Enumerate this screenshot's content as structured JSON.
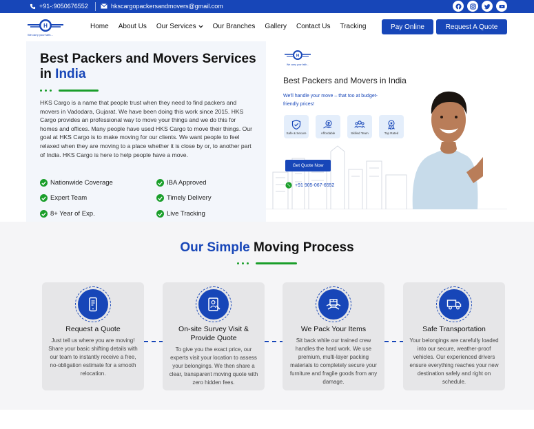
{
  "topbar": {
    "phone": "+91-:9050676552",
    "email": "hkscargopackersandmovers@gmail.com",
    "socials": [
      "facebook-icon",
      "instagram-icon",
      "twitter-icon",
      "youtube-icon"
    ]
  },
  "nav": {
    "logo_tagline": "We carry your faith...",
    "items": [
      "Home",
      "About Us",
      "Our Services",
      "Our Branches",
      "Gallery",
      "Contact Us",
      "Tracking"
    ],
    "pay_online": "Pay Online",
    "request_quote": "Request A Quote"
  },
  "hero": {
    "title_main": "Best Packers and Movers Services in ",
    "title_accent": "India",
    "paragraph": "HKS Cargo is a name that people trust when they need to find packers and movers in Vadodara, Gujarat. We have been doing this work since 2015. HKS Cargo provides an professional way to move your things and we do this for homes and offices. Many people have used HKS Cargo to move their things. Our goal at HKS Cargo is to make moving for our clients. We want people to feel relaxed when they are moving to a place whether it is close by or, to another part of India. HKS Cargo is here to help people have a move.",
    "features": [
      "Nationwide Coverage",
      "IBA Approved",
      "Expert Team",
      "Timely Delivery",
      "8+ Year of Exp.",
      "Live Tracking"
    ]
  },
  "banner": {
    "tagline": "We carry your faith...",
    "title": "Best Packers and Movers in India",
    "subtitle": "We'll handle your move – that too at budget-friendly prices!",
    "badges": [
      "Safe & Secure",
      "Affordable",
      "Skilled Team",
      "Top Rated"
    ],
    "cta": "Get Quote Now",
    "phone": "+91 905-067-6552"
  },
  "process": {
    "title_accent": "Our Simple",
    "title_main": " Moving Process",
    "steps": [
      {
        "title": "Request a Quote",
        "desc": "Just tell us where you are moving! Share your basic shifting details with our team to instantly receive a free, no-obligation estimate for a smooth relocation."
      },
      {
        "title": "On-site Survey Visit & Provide Quote",
        "desc": "To give you the exact price, our experts visit your location to assess your belongings. We then share a clear, transparent moving quote with zero hidden fees."
      },
      {
        "title": "We Pack Your Items",
        "desc": "Sit back while our trained crew handles the hard work. We use premium, multi-layer packing materials to completely secure your furniture and fragile goods from any damage."
      },
      {
        "title": "Safe Transportation",
        "desc": "Your belongings are carefully loaded into our secure, weather-proof vehicles. Our experienced drivers ensure everything reaches your new destination safely and right on schedule."
      }
    ]
  },
  "colors": {
    "primary": "#1746b8",
    "accent_green": "#1a9e2a"
  }
}
